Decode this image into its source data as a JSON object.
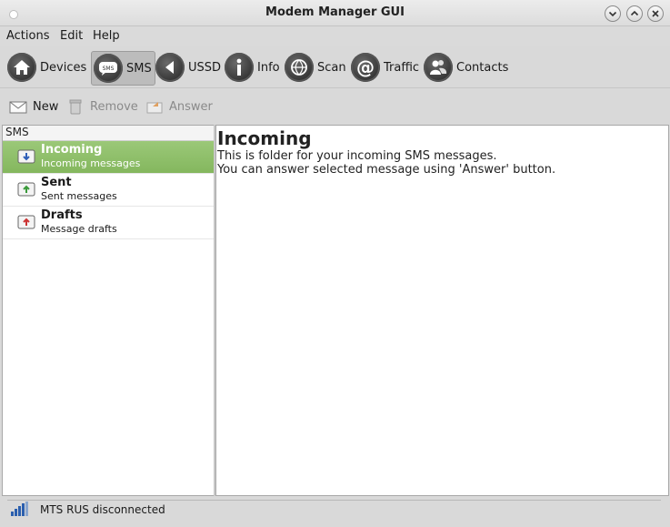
{
  "window": {
    "title": "Modem Manager GUI"
  },
  "menubar": {
    "items": [
      "Actions",
      "Edit",
      "Help"
    ]
  },
  "toolbar": {
    "items": [
      {
        "label": "Devices",
        "icon": "home-icon",
        "active": false
      },
      {
        "label": "SMS",
        "icon": "sms-icon",
        "active": true
      },
      {
        "label": "USSD",
        "icon": "ussd-icon",
        "active": false
      },
      {
        "label": "Info",
        "icon": "info-icon",
        "active": false
      },
      {
        "label": "Scan",
        "icon": "scan-icon",
        "active": false
      },
      {
        "label": "Traffic",
        "icon": "traffic-icon",
        "active": false
      },
      {
        "label": "Contacts",
        "icon": "contacts-icon",
        "active": false
      }
    ]
  },
  "actions": {
    "new_label": "New",
    "remove_label": "Remove",
    "answer_label": "Answer"
  },
  "folders": {
    "header": "SMS",
    "items": [
      {
        "name": "Incoming",
        "desc": "Incoming messages",
        "selected": true
      },
      {
        "name": "Sent",
        "desc": "Sent messages",
        "selected": false
      },
      {
        "name": "Drafts",
        "desc": "Message drafts",
        "selected": false
      }
    ]
  },
  "detail": {
    "title": "Incoming",
    "line1": "This is folder for your incoming SMS messages.",
    "line2": "You can answer selected message using 'Answer' button."
  },
  "status": {
    "text": "MTS RUS disconnected"
  },
  "colors": {
    "selection": "#8cbd66",
    "window_bg": "#d9d9d9"
  }
}
